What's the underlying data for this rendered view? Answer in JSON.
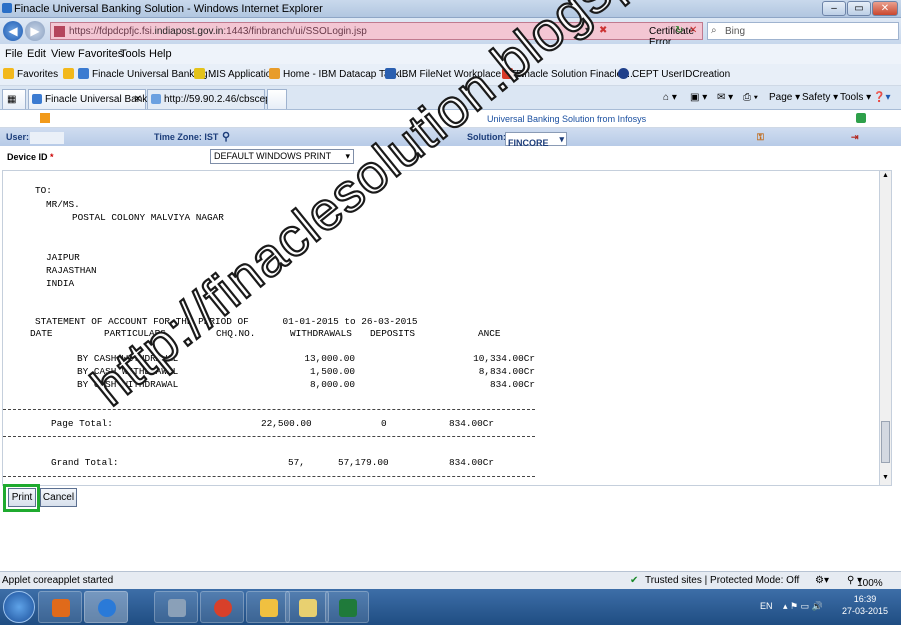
{
  "window": {
    "title": "Finacle Universal Banking Solution - Windows Internet Explorer",
    "controls": [
      "–",
      "▭",
      "✕"
    ]
  },
  "address": {
    "url_prefix": "https://fdpdcpfjc.fsi.",
    "url_host": "indiapost.gov.in",
    "url_suffix": ":1443/finbranch/ui/SSOLogin.jsp",
    "cert_error": "Certificate Error",
    "search_placeholder": "Bing"
  },
  "menu": [
    "File",
    "Edit",
    "View",
    "Favorites",
    "Tools",
    "Help"
  ],
  "favorites": {
    "label": "Favorites",
    "items": [
      "Finacle Universal Banking ...",
      "MIS Application",
      "Home - IBM Datacap Task...",
      "IBM FileNet Workplace XT...",
      "Finacle Solution  Finacle i...",
      "CEPT UserIDCreation"
    ]
  },
  "tabs": [
    "Finacle Universal Banki...",
    "http://59.90.2.46/cbscept/..."
  ],
  "commands": [
    "Page ▾",
    "Safety ▾",
    "Tools ▾"
  ],
  "app": {
    "banner": "Universal Banking Solution from Infosys",
    "user_label": "User:",
    "timezone": "Time Zone: IST",
    "solution_label": "Solution:",
    "solution_value": "FINCORE",
    "device_label": "Device ID",
    "device_value": "DEFAULT WINDOWS PRINT"
  },
  "report": {
    "to": "TO:",
    "salutation": "MR/MS.",
    "address_line": "POSTAL COLONY MALVIYA NAGAR",
    "city": "JAIPUR",
    "state": "RAJASTHAN",
    "country": "INDIA",
    "statement_line": "STATEMENT OF ACCOUNT FOR THE PERIOD OF      01-01-2015 to 26-03-2015",
    "columns": [
      "DATE",
      "PARTICULARS",
      "CHQ.NO.",
      "WITHDRAWALS",
      "DEPOSITS",
      "ANCE"
    ],
    "rows": [
      {
        "particulars": "BY CASH WITHDRAWAL",
        "withdrawal": "13,000.00",
        "balance": "10,334.00Cr"
      },
      {
        "particulars": "BY CASH WITHDRAWAL",
        "withdrawal": "1,500.00",
        "balance": "8,834.00Cr"
      },
      {
        "particulars": "BY CASH WITHDRAWAL",
        "withdrawal": "8,000.00",
        "balance": "834.00Cr"
      }
    ],
    "page_total_label": "Page Total:",
    "page_total_withdrawals": "22,500.00",
    "page_total_deposits": "0",
    "page_total_balance": "834.00Cr",
    "grand_total_label": "Grand Total:",
    "grand_total_withdrawals": "57,",
    "grand_total_deposits": "57,179.00",
    "grand_total_balance": "834.00Cr"
  },
  "buttons": {
    "print": "Print",
    "cancel": "Cancel"
  },
  "status": {
    "left": "Applet coreapplet started",
    "zone": "Trusted sites | Protected Mode: Off",
    "zoom": "100%"
  },
  "taskbar": {
    "lang": "EN",
    "time": "16:39",
    "date": "27-03-2015"
  },
  "watermark": "http://finaclesolution.blogspot.in",
  "colors": {
    "highlight": "#1faa2f",
    "address_error_bg": "#f3c6d3",
    "info_text": "#1c3d7a"
  }
}
